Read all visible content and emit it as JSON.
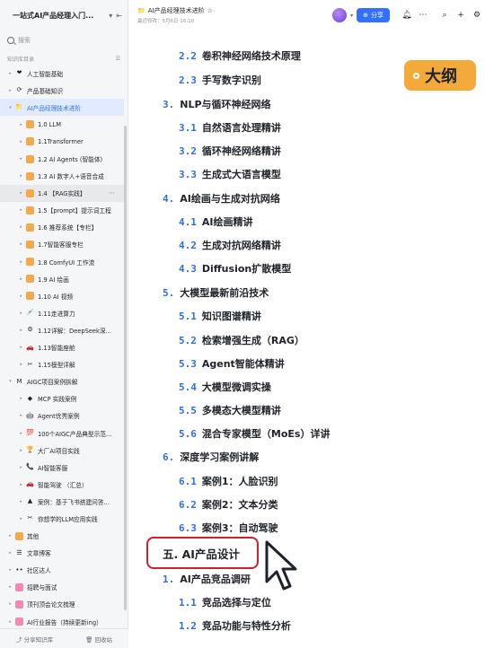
{
  "sidebar": {
    "title": "一站式AI产品经理入门...",
    "search_placeholder": "搜索",
    "directory_label": "知识库目录",
    "items": [
      {
        "label": "人工智能基础",
        "icon": "❤",
        "caret": "▸",
        "indent": 1
      },
      {
        "label": "产品基础知识",
        "icon": "⟳",
        "caret": "▸",
        "indent": 1
      },
      {
        "label": "AI产品经理技术进阶",
        "icon": "📁",
        "caret": "▾",
        "indent": 1,
        "active": true
      },
      {
        "label": "1.0 LLM",
        "icon": "sq",
        "caret": "▸",
        "indent": 2
      },
      {
        "label": "1.1Transformer",
        "icon": "sq",
        "caret": "▸",
        "indent": 2
      },
      {
        "label": "1.2 AI Agents (智能体)",
        "icon": "sq",
        "caret": "▸",
        "indent": 2
      },
      {
        "label": "1.3 AI 数字人+语音合成",
        "icon": "sq",
        "caret": "▸",
        "indent": 2
      },
      {
        "label": "1.4 【RAG实践】",
        "icon": "sq",
        "caret": "▸",
        "indent": 2,
        "hover": true
      },
      {
        "label": "1.5【prompt】提示词工程",
        "icon": "sq",
        "caret": "▸",
        "indent": 2
      },
      {
        "label": "1.6 推荐系统【专栏】",
        "icon": "sq",
        "caret": "▸",
        "indent": 2
      },
      {
        "label": "1.7智能客服专栏",
        "icon": "sq",
        "caret": "▸",
        "indent": 2
      },
      {
        "label": "1.8 ComfyUI 工作流",
        "icon": "sq",
        "caret": "▸",
        "indent": 2
      },
      {
        "label": "1.9 AI 绘画",
        "icon": "sq",
        "caret": "▸",
        "indent": 2
      },
      {
        "label": "1.10 AI 视频",
        "icon": "sq",
        "caret": "▸",
        "indent": 2
      },
      {
        "label": "1.11走进算力",
        "icon": "💉",
        "caret": "▸",
        "indent": 2
      },
      {
        "label": "1.12详解：DeepSeek深...",
        "icon": "⚙",
        "caret": "▸",
        "indent": 2
      },
      {
        "label": "1.13智能座舱",
        "icon": "🚗",
        "caret": "▸",
        "indent": 2
      },
      {
        "label": "1.15模型评解",
        "icon": "✂",
        "caret": "▸",
        "indent": 2
      },
      {
        "label": "AIGC项目案例拆解",
        "icon": "M",
        "caret": "▾",
        "indent": 1
      },
      {
        "label": "MCP 实践案例",
        "icon": "◆",
        "caret": "▸",
        "indent": 2
      },
      {
        "label": "Agent优秀案例",
        "icon": "🤖",
        "caret": "▸",
        "indent": 2
      },
      {
        "label": "100个AIGC产品典型示范...",
        "icon": "💯",
        "caret": "▸",
        "indent": 2
      },
      {
        "label": "大厂AI项目实践",
        "icon": "🏆",
        "caret": "▸",
        "indent": 2
      },
      {
        "label": "AI智能客服",
        "icon": "📞",
        "caret": "▸",
        "indent": 2
      },
      {
        "label": "智能驾驶 （汇总）",
        "icon": "🚗",
        "caret": "▸",
        "indent": 2
      },
      {
        "label": "案例：基于飞书搭建问答...",
        "icon": "▲",
        "caret": "▸",
        "indent": 2
      },
      {
        "label": "你想学的LLM应用实践",
        "icon": "✂",
        "caret": "▸",
        "indent": 2
      },
      {
        "label": "其他",
        "icon": "sq",
        "caret": "▸",
        "indent": 1
      },
      {
        "label": "文章博客",
        "icon": "☰",
        "caret": "▸",
        "indent": 1
      },
      {
        "label": "社区达人",
        "icon": "••",
        "caret": "▸",
        "indent": 1
      },
      {
        "label": "招聘与面试",
        "icon": "sq",
        "caret": "▸",
        "indent": 1
      },
      {
        "label": "顶刊顶会论文梳理",
        "icon": "sq",
        "caret": "▸",
        "indent": 1
      },
      {
        "label": "AI行业报告（持续更新ing）",
        "icon": "sq",
        "caret": "▸",
        "indent": 1
      }
    ],
    "footer_share": "分享知识库",
    "footer_trash": "回收站"
  },
  "topbar": {
    "doc_title": "AI产品经理技术进阶",
    "last_modified": "最近修改：5月6日 16:10",
    "share_label": "分享"
  },
  "badge": {
    "label": "大纲"
  },
  "outline": [
    {
      "num": "2.2",
      "text": "卷积神经网络技术原理",
      "level": 2
    },
    {
      "num": "2.3",
      "text": "手写数字识别",
      "level": 2
    },
    {
      "num": "3.",
      "text": "NLP与循环神经网络",
      "level": 1
    },
    {
      "num": "3.1",
      "text": "自然语言处理精讲",
      "level": 2
    },
    {
      "num": "3.2",
      "text": "循环神经网络精讲",
      "level": 2
    },
    {
      "num": "3.3",
      "text": "生成式大语言模型",
      "level": 2
    },
    {
      "num": "4.",
      "text": "AI绘画与生成对抗网络",
      "level": 1
    },
    {
      "num": "4.1",
      "text": "AI绘画精讲",
      "level": 2
    },
    {
      "num": "4.2",
      "text": "生成对抗网络精讲",
      "level": 2
    },
    {
      "num": "4.3",
      "text": "Diffusion扩散模型",
      "level": 2
    },
    {
      "num": "5.",
      "text": "大模型最新前沿技术",
      "level": 1
    },
    {
      "num": "5.1",
      "text": "知识图谱精讲",
      "level": 2
    },
    {
      "num": "5.2",
      "text": "检索增强生成（RAG）",
      "level": 2
    },
    {
      "num": "5.3",
      "text": "Agent智能体精讲",
      "level": 2
    },
    {
      "num": "5.4",
      "text": "大模型微调实操",
      "level": 2
    },
    {
      "num": "5.5",
      "text": "多模态大模型精讲",
      "level": 2
    },
    {
      "num": "5.6",
      "text": "混合专家模型（MoEs）详讲",
      "level": 2
    },
    {
      "num": "6.",
      "text": "深度学习案例讲解",
      "level": 1
    },
    {
      "num": "6.1",
      "text": "案例1：人脸识别",
      "level": 2
    },
    {
      "num": "6.2",
      "text": "案例2：文本分类",
      "level": 2
    },
    {
      "num": "6.3",
      "text": "案例3：自动驾驶",
      "level": 2
    },
    {
      "num": "",
      "text": "",
      "level": 0
    },
    {
      "num": "1.",
      "text": "AI产品竞品调研",
      "level": 1
    },
    {
      "num": "1.1",
      "text": "竞品选择与定位",
      "level": 2
    },
    {
      "num": "1.2",
      "text": "竞品功能与特性分析",
      "level": 2
    }
  ],
  "section_heading": "五. AI产品设计"
}
